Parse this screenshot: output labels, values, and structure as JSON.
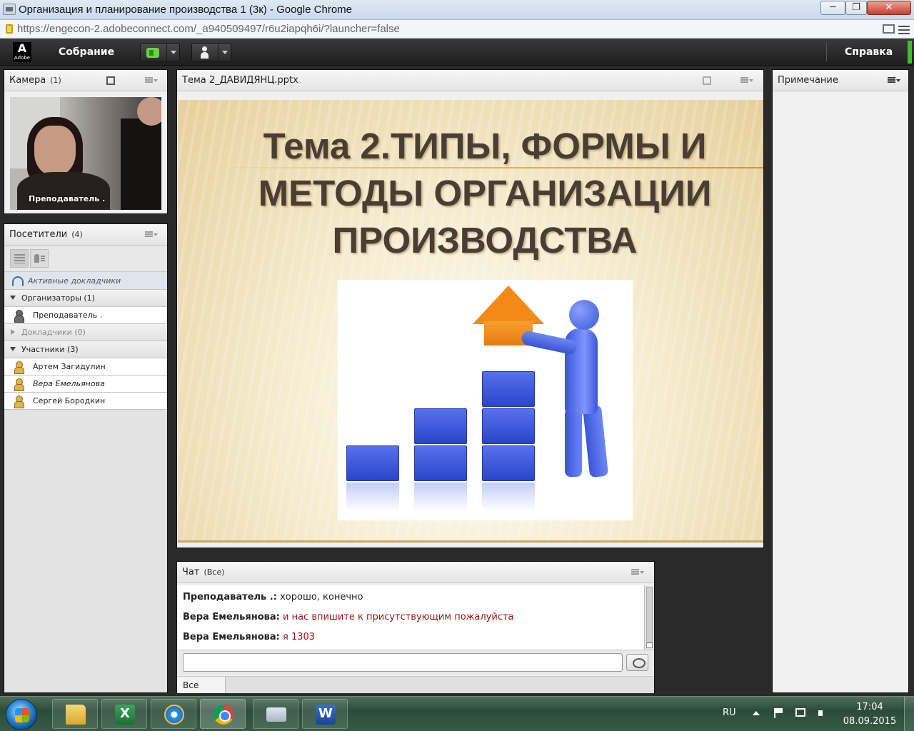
{
  "window": {
    "title": "Организация и планирование производства 1 (3к) - Google Chrome",
    "min_label": "─",
    "max_label": "❐",
    "close_label": "✕"
  },
  "address": {
    "url_host": "https://engecon-2.adobeconnect.com",
    "url_path": "/_a940509497/r6u2iapqh6i/?launcher=false"
  },
  "connect": {
    "logo_text": "Adobe",
    "logo_letter": "A",
    "meeting_menu": "Собрание",
    "help_menu": "Справка"
  },
  "camera": {
    "title": "Камера",
    "count": "(1)",
    "video_label": "Преподаватель ."
  },
  "attendees": {
    "title": "Посетители",
    "count": "(4)",
    "active_speakers": "Активные докладчики",
    "groups": {
      "hosts": "Организаторы (1)",
      "presenters": "Докладчики (0)",
      "participants": "Участники (3)"
    },
    "hosts": [
      "Преподаватель ."
    ],
    "participants": [
      "Артем Загидулин",
      "Вера Емельянова",
      "Сергей Бородкин"
    ]
  },
  "share": {
    "title": "Тема 2_ДАВИДЯНЦ.pptx",
    "slide_title": "Тема 2.ТИПЫ, ФОРМЫ И\nМЕТОДЫ ОРГАНИЗАЦИИ\nПРОИЗВОДСТВА"
  },
  "note": {
    "title": "Примечание"
  },
  "chat": {
    "title": "Чат",
    "scope": "(Все)",
    "messages": [
      {
        "sender": "Преподаватель .:",
        "text": "хорошо, конечно",
        "color": "#222222"
      },
      {
        "sender": "Вера Емельянова:",
        "text": "и нас впишите к присутствующим пожалуйста",
        "color": "#a01414"
      },
      {
        "sender": "Вера Емельянова:",
        "text": "я 1303",
        "color": "#a01414"
      }
    ],
    "input_value": "",
    "tab_all": "Все"
  },
  "taskbar": {
    "apps": [
      "folder-icon",
      "excel-icon",
      "ie-icon",
      "chrome-icon",
      "keyboard-icon",
      "word-icon"
    ],
    "lang": "RU",
    "time": "17:04",
    "date": "08.09.2015"
  },
  "colors": {
    "accent_green": "#3fbf2a",
    "chat_red": "#a01414",
    "slide_title": "#4a3d34"
  }
}
